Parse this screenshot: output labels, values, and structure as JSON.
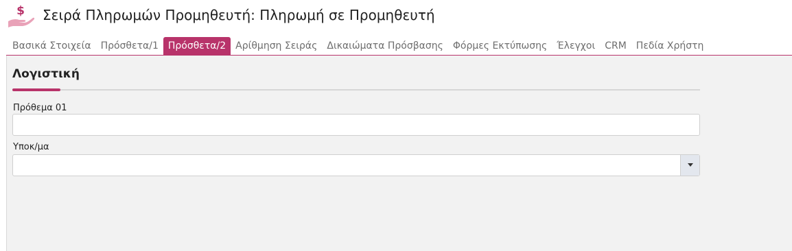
{
  "header": {
    "title": "Σειρά Πληρωμών Προμηθευτή: Πληρωμή σε Προμηθευτή",
    "icon": "hand-dollar-icon",
    "accent_color": "#b8336a"
  },
  "tabs": [
    {
      "label": "Βασικά Στοιχεία",
      "active": false
    },
    {
      "label": "Πρόσθετα/1",
      "active": false
    },
    {
      "label": "Πρόσθετα/2",
      "active": true
    },
    {
      "label": "Αρίθμηση Σειράς",
      "active": false
    },
    {
      "label": "Δικαιώματα Πρόσβασης",
      "active": false
    },
    {
      "label": "Φόρμες Εκτύπωσης",
      "active": false
    },
    {
      "label": "Έλεγχοι",
      "active": false
    },
    {
      "label": "CRM",
      "active": false
    },
    {
      "label": "Πεδία Χρήστη",
      "active": false
    }
  ],
  "section": {
    "title": "Λογιστική"
  },
  "fields": {
    "prefix": {
      "label": "Πρόθεμα 01",
      "value": ""
    },
    "branch": {
      "label": "Υποκ/μα",
      "value": "",
      "arrow_icon": "caret-down-icon"
    }
  }
}
